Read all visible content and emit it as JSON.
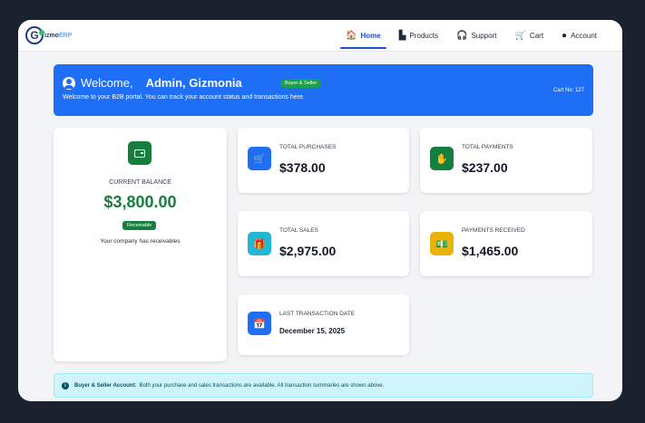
{
  "brand": {
    "logo_letter": "G",
    "name": "izmo",
    "suffix": "ERP"
  },
  "nav": {
    "items": [
      {
        "icon": "home-icon",
        "glyph": "🏠",
        "label": "Home",
        "active": true
      },
      {
        "icon": "products-icon",
        "glyph": "▙",
        "label": "Products",
        "active": false
      },
      {
        "icon": "headset-icon",
        "glyph": "🎧",
        "label": "Support",
        "active": false
      },
      {
        "icon": "cart-icon",
        "glyph": "🛒",
        "label": "Cart",
        "active": false
      },
      {
        "icon": "user-circle-icon",
        "glyph": "●",
        "label": "Account",
        "active": false
      }
    ]
  },
  "welcome": {
    "greeting": "Welcome,",
    "name": "Admin, Gizmonia",
    "role_badge": "Buyer & Seller",
    "subtitle": "Welcome to your B2B portal. You can track your account status and transactions here.",
    "cart_no": "Cart No: 127"
  },
  "balance": {
    "label": "CURRENT BALANCE",
    "value": "$3,800.00",
    "badge": "Receivable",
    "note": "Your company has receivables"
  },
  "stats": {
    "total_purchases": {
      "label": "TOTAL PURCHASES",
      "value": "$378.00",
      "icon": "cart-icon",
      "color": "#1e6ff5"
    },
    "total_payments": {
      "label": "TOTAL PAYMENTS",
      "value": "$237.00",
      "icon": "hand-coin-icon",
      "color": "#15803d"
    },
    "total_sales": {
      "label": "TOTAL SALES",
      "value": "$2,975.00",
      "icon": "gift-icon",
      "color": "#22b8d4"
    },
    "payments_received": {
      "label": "PAYMENTS RECEIVED",
      "value": "$1,465.00",
      "icon": "cash-icon",
      "color": "#eab308"
    },
    "last_transaction": {
      "label": "LAST TRANSACTION DATE",
      "value": "December 15, 2025",
      "icon": "calendar-icon",
      "color": "#1e6ff5"
    }
  },
  "info": {
    "bold": "Buyer & Seller Account:",
    "text": "Both your purchase and sales transactions are available. All transaction summaries are shown above."
  }
}
